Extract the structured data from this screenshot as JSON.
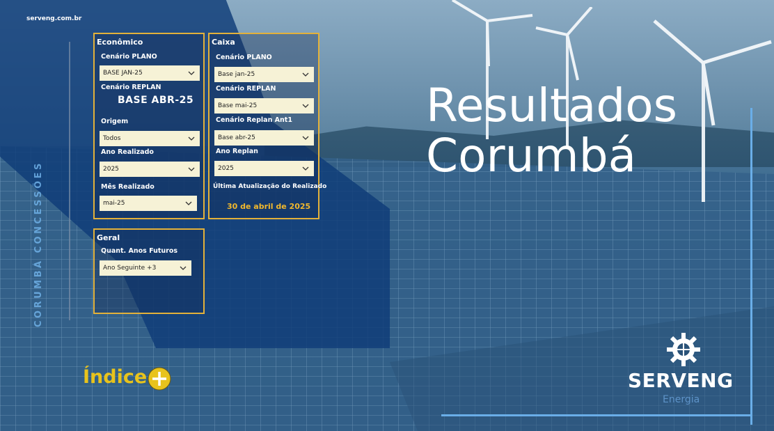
{
  "brand_url": "serveng.com.br",
  "vertical_label": "CORUMBÁ CONCESSÕES",
  "title_line1": "Resultados",
  "title_line2": "Corumbá",
  "economico": {
    "title": "Econômico",
    "cenario_plano_label": "Cenário PLANO",
    "cenario_plano_value": "BASE JAN-25",
    "cenario_replan_label": "Cenário REPLAN",
    "cenario_replan_value": "BASE ABR-25",
    "origem_label": "Origem",
    "origem_value": "Todos",
    "ano_realizado_label": "Ano Realizado",
    "ano_realizado_value": "2025",
    "mes_realizado_label": "Mês Realizado",
    "mes_realizado_value": "mai-25"
  },
  "caixa": {
    "title": "Caixa",
    "cenario_plano_label": "Cenário PLANO",
    "cenario_plano_value": "Base jan-25",
    "cenario_replan_label": "Cenário REPLAN",
    "cenario_replan_value": "Base mai-25",
    "cenario_replan_ant1_label": "Cenário Replan Ant1",
    "cenario_replan_ant1_value": "Base abr-25",
    "ano_replan_label": "Ano Replan",
    "ano_replan_value": "2025",
    "ultima_atualizacao_label": "Última Atualização do Realizado",
    "ultima_atualizacao_value": "30 de abril de 2025"
  },
  "geral": {
    "title": "Geral",
    "quant_anos_label": "Quant. Anos Futuros",
    "quant_anos_value": "Ano Seguinte +3"
  },
  "indice_label": "Índice",
  "logo": {
    "name": "SERVENG",
    "sub": "Energia"
  },
  "colors": {
    "accent_gold": "#e3b13a",
    "accent_blue": "#6aaee8",
    "dropdown_bg": "#f6f2d6",
    "indice_yellow": "#e8c31c"
  }
}
